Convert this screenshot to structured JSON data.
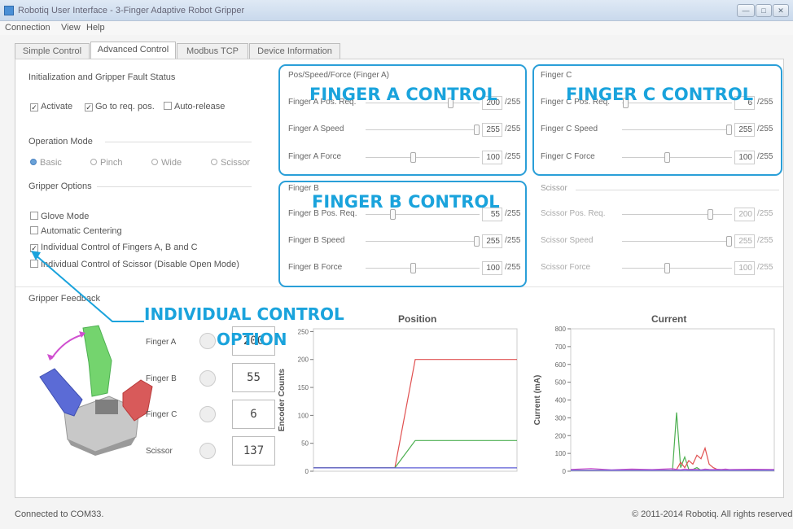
{
  "window": {
    "title": "Robotiq User Interface - 3-Finger Adaptive Robot Gripper",
    "controls": [
      "—",
      "□",
      "✕"
    ]
  },
  "menu": [
    "Connection",
    "View",
    "Help"
  ],
  "tabs": [
    {
      "label": "Simple Control",
      "active": false
    },
    {
      "label": "Advanced Control",
      "active": true
    },
    {
      "label": "Modbus TCP",
      "active": false
    },
    {
      "label": "Device Information",
      "active": false
    }
  ],
  "init": {
    "title": "Initialization and Gripper Fault Status",
    "activate": {
      "label": "Activate",
      "checked": true
    },
    "goto": {
      "label": "Go to req. pos.",
      "checked": true
    },
    "autorelease": {
      "label": "Auto-release",
      "checked": false
    }
  },
  "operation": {
    "title": "Operation Mode",
    "modes": [
      {
        "label": "Basic",
        "selected": true
      },
      {
        "label": "Pinch",
        "selected": false
      },
      {
        "label": "Wide",
        "selected": false
      },
      {
        "label": "Scissor",
        "selected": false
      }
    ]
  },
  "options": {
    "title": "Gripper Options",
    "items": [
      {
        "label": "Glove Mode",
        "checked": false
      },
      {
        "label": "Automatic Centering",
        "checked": false
      },
      {
        "label": "Individual Control of Fingers A, B and C",
        "checked": true
      },
      {
        "label": "Individual Control of Scissor (Disable Open Mode)",
        "checked": false
      }
    ]
  },
  "finger_a": {
    "title": "Pos/Speed/Force (Finger A)",
    "rows": [
      {
        "label": "Finger A Pos. Req.",
        "value": "200",
        "max": "/255",
        "level": 0.78
      },
      {
        "label": "Finger A Speed",
        "value": "255",
        "max": "/255",
        "level": 1.0
      },
      {
        "label": "Finger A Force",
        "value": "100",
        "max": "/255",
        "level": 0.39
      }
    ]
  },
  "finger_b": {
    "title": "Finger B",
    "rows": [
      {
        "label": "Finger B Pos. Req.",
        "value": "55",
        "max": "/255",
        "level": 0.22
      },
      {
        "label": "Finger B Speed",
        "value": "255",
        "max": "/255",
        "level": 1.0
      },
      {
        "label": "Finger B Force",
        "value": "100",
        "max": "/255",
        "level": 0.39
      }
    ]
  },
  "finger_c": {
    "title": "Finger C",
    "rows": [
      {
        "label": "Finger C Pos. Req.",
        "value": "6",
        "max": "/255",
        "level": 0.02
      },
      {
        "label": "Finger C Speed",
        "value": "255",
        "max": "/255",
        "level": 1.0
      },
      {
        "label": "Finger C Force",
        "value": "100",
        "max": "/255",
        "level": 0.39
      }
    ]
  },
  "scissor": {
    "title": "Scissor",
    "rows": [
      {
        "label": "Scissor Pos. Req.",
        "value": "200",
        "max": "/255",
        "level": 0.78
      },
      {
        "label": "Scissor Speed",
        "value": "255",
        "max": "/255",
        "level": 1.0
      },
      {
        "label": "Scissor Force",
        "value": "100",
        "max": "/255",
        "level": 0.39
      }
    ]
  },
  "annotations": {
    "finger_a": "FINGER A CONTROL",
    "finger_b": "FINGER B CONTROL",
    "finger_c": "FINGER C CONTROL",
    "individual_1": "INDIVIDUAL CONTROL",
    "individual_2": "OPTION",
    "color": "#1aa3dc"
  },
  "feedback": {
    "title": "Gripper Feedback",
    "rows": [
      {
        "label": "Finger A",
        "color": "#e05050",
        "value": "200"
      },
      {
        "label": "Finger B",
        "color": "#4caf50",
        "value": "55"
      },
      {
        "label": "Finger C",
        "color": "#5b5bd6",
        "value": "6"
      },
      {
        "label": "Scissor",
        "color": "#d050d0",
        "value": "137"
      }
    ]
  },
  "status": {
    "left": "Connected to COM33.",
    "right": "© 2011-2014 Robotiq. All rights reserved."
  },
  "chart_data": [
    {
      "type": "line",
      "title": "Position",
      "ylabel": "Encoder Counts",
      "xlabel": "",
      "ylim": [
        0,
        255
      ],
      "yticks": [
        0,
        50,
        100,
        150,
        200,
        250
      ],
      "x": [
        0,
        10,
        20,
        30,
        40,
        50,
        60,
        70,
        80,
        90,
        100
      ],
      "series": [
        {
          "color": "#e05050",
          "values": [
            6,
            6,
            6,
            6,
            6,
            200,
            200,
            200,
            200,
            200,
            200
          ]
        },
        {
          "color": "#4caf50",
          "values": [
            6,
            6,
            6,
            6,
            6,
            55,
            55,
            55,
            55,
            55,
            55
          ]
        },
        {
          "color": "#5b5bd6",
          "values": [
            6,
            6,
            6,
            6,
            6,
            6,
            6,
            6,
            6,
            6,
            6
          ]
        }
      ]
    },
    {
      "type": "line",
      "title": "Current",
      "ylabel": "Current (mA)",
      "xlabel": "",
      "ylim": [
        0,
        800
      ],
      "yticks": [
        0,
        100,
        200,
        300,
        400,
        500,
        600,
        700,
        800
      ],
      "x": [
        0,
        10,
        20,
        30,
        40,
        50,
        52,
        54,
        56,
        58,
        60,
        62,
        64,
        66,
        68,
        70,
        72,
        74,
        76,
        78,
        80,
        90,
        100
      ],
      "series": [
        {
          "color": "#4caf50",
          "values": [
            5,
            5,
            5,
            5,
            5,
            5,
            330,
            20,
            80,
            10,
            10,
            20,
            5,
            5,
            5,
            5,
            5,
            5,
            5,
            5,
            5,
            5,
            5
          ]
        },
        {
          "color": "#e05050",
          "values": [
            5,
            5,
            5,
            5,
            5,
            5,
            10,
            50,
            20,
            60,
            40,
            90,
            70,
            130,
            40,
            20,
            10,
            5,
            5,
            5,
            5,
            5,
            5
          ]
        },
        {
          "color": "#d050d0",
          "values": [
            10,
            15,
            8,
            12,
            9,
            14,
            10,
            8,
            12,
            9,
            11,
            10,
            8,
            12,
            10,
            9,
            11,
            10,
            12,
            9,
            10,
            11,
            10
          ]
        },
        {
          "color": "#5b5bd6",
          "values": [
            5,
            5,
            5,
            5,
            5,
            5,
            5,
            5,
            5,
            5,
            5,
            5,
            5,
            5,
            5,
            5,
            5,
            5,
            5,
            5,
            5,
            5,
            5
          ]
        }
      ]
    }
  ]
}
